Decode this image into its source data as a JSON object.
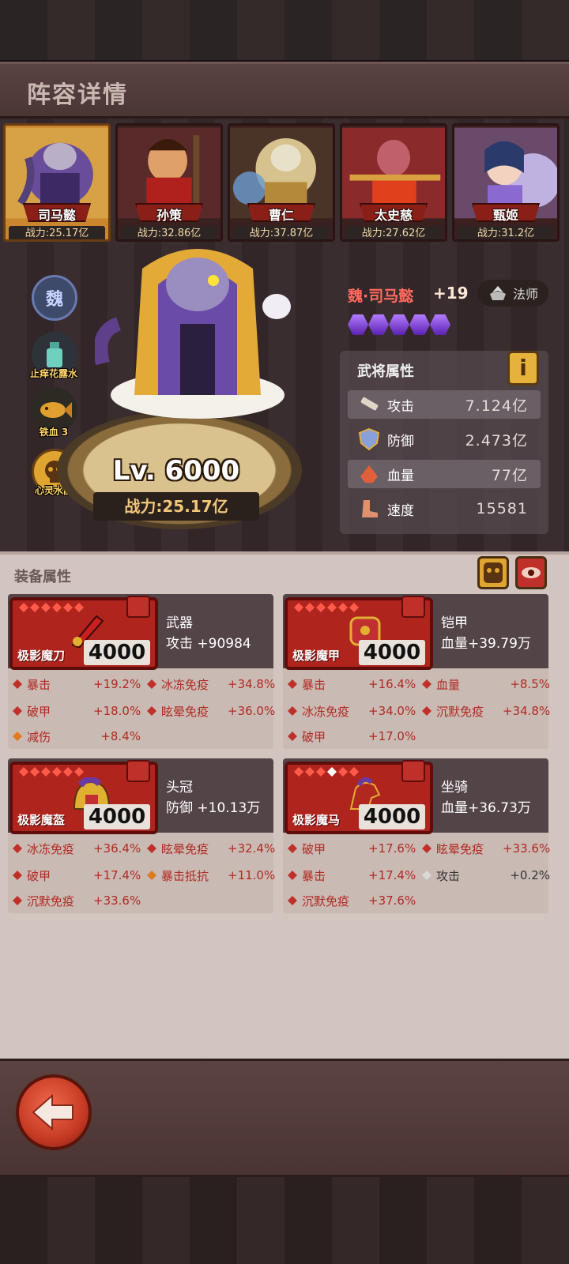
{
  "title": "阵容详情",
  "heroes": [
    {
      "name": "司马懿",
      "power": "战力:25.17亿"
    },
    {
      "name": "孙策",
      "power": "战力:32.86亿"
    },
    {
      "name": "曹仁",
      "power": "战力:37.87亿"
    },
    {
      "name": "太史慈",
      "power": "战力:27.62亿"
    },
    {
      "name": "甄姬",
      "power": "战力:31.2亿"
    }
  ],
  "side": {
    "faction": "魏",
    "item1": "止痒花露水",
    "item2": "铁血",
    "item2_suffix": "3",
    "item3": "心灵水晶"
  },
  "selected": {
    "name": "魏·司马懿",
    "plus": "+19",
    "class": "法师",
    "level": "Lv. 6000",
    "power": "战力:25.17亿"
  },
  "attrs": {
    "title": "武将属性",
    "info": "i",
    "rows": [
      {
        "label": "攻击",
        "value": "7.124亿"
      },
      {
        "label": "防御",
        "value": "2.473亿"
      },
      {
        "label": "血量",
        "value": "77亿"
      },
      {
        "label": "速度",
        "value": "15581"
      }
    ]
  },
  "equipment": {
    "title": "装备属性",
    "items": [
      {
        "name": "极影魔刀",
        "level": "4000",
        "type": "武器",
        "main": "攻击 +90984",
        "subs": [
          {
            "label": "暴击",
            "value": "+19.2%"
          },
          {
            "label": "冰冻免疫",
            "value": "+34.8%"
          },
          {
            "label": "破甲",
            "value": "+18.0%"
          },
          {
            "label": "眩晕免疫",
            "value": "+36.0%"
          },
          {
            "label": "减伤",
            "value": "+8.4%"
          }
        ]
      },
      {
        "name": "极影魔甲",
        "level": "4000",
        "type": "铠甲",
        "main": "血量+39.79万",
        "subs": [
          {
            "label": "暴击",
            "value": "+16.4%"
          },
          {
            "label": "血量",
            "value": "+8.5%"
          },
          {
            "label": "冰冻免疫",
            "value": "+34.0%"
          },
          {
            "label": "沉默免疫",
            "value": "+34.8%"
          },
          {
            "label": "破甲",
            "value": "+17.0%"
          }
        ]
      },
      {
        "name": "极影魔盔",
        "level": "4000",
        "type": "头冠",
        "main": "防御 +10.13万",
        "subs": [
          {
            "label": "冰冻免疫",
            "value": "+36.4%"
          },
          {
            "label": "眩晕免疫",
            "value": "+32.4%"
          },
          {
            "label": "破甲",
            "value": "+17.4%"
          },
          {
            "label": "暴击抵抗",
            "value": "+11.0%"
          },
          {
            "label": "沉默免疫",
            "value": "+33.6%"
          }
        ]
      },
      {
        "name": "极影魔马",
        "level": "4000",
        "type": "坐骑",
        "main": "血量+36.73万",
        "subs": [
          {
            "label": "破甲",
            "value": "+17.6%"
          },
          {
            "label": "眩晕免疫",
            "value": "+33.6%"
          },
          {
            "label": "暴击",
            "value": "+17.4%"
          },
          {
            "label": "攻击",
            "value": "+0.2%"
          },
          {
            "label": "沉默免疫",
            "value": "+37.6%"
          }
        ]
      }
    ]
  },
  "colors": {
    "accent_red": "#b22a22",
    "gold": "#f0c779",
    "orange_dot": "#e07a20",
    "white_dot": "#d8d8d8"
  }
}
